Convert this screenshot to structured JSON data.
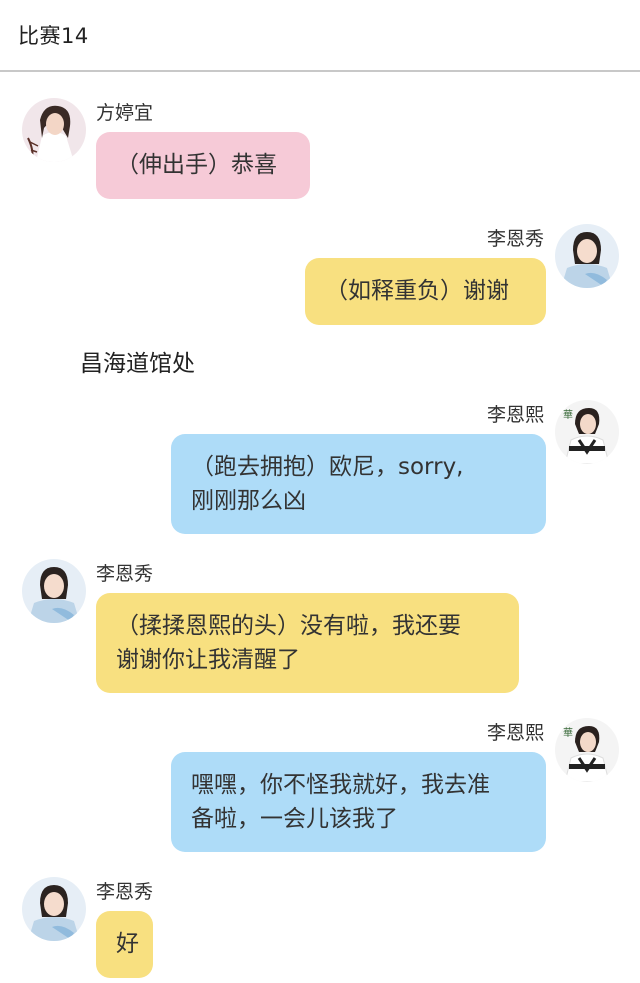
{
  "header": {
    "title": "比赛14"
  },
  "colors": {
    "pink": "#f6cad7",
    "yellow": "#f8e080",
    "blue": "#aedcf8"
  },
  "messages": [
    {
      "side": "left",
      "sender": "方婷宜",
      "text": "（伸出手）恭喜",
      "color": "pink"
    },
    {
      "side": "right",
      "sender": "李恩秀",
      "text": "（如释重负）谢谢",
      "color": "yellow"
    },
    {
      "side": "center",
      "text": "昌海道馆处"
    },
    {
      "side": "right",
      "sender": "李恩熙",
      "lines": [
        "（跑去拥抱）欧尼，sorry,",
        "刚刚那么凶"
      ],
      "color": "blue"
    },
    {
      "side": "left",
      "sender": "李恩秀",
      "lines": [
        "（揉揉恩熙的头）没有啦，我还要",
        "谢谢你让我清醒了"
      ],
      "color": "yellow"
    },
    {
      "side": "right",
      "sender": "李恩熙",
      "lines": [
        "嘿嘿，你不怪我就好，我去准",
        "备啦，一会儿该我了"
      ],
      "color": "blue"
    },
    {
      "side": "left",
      "sender": "李恩秀",
      "text": "好",
      "color": "yellow"
    }
  ]
}
